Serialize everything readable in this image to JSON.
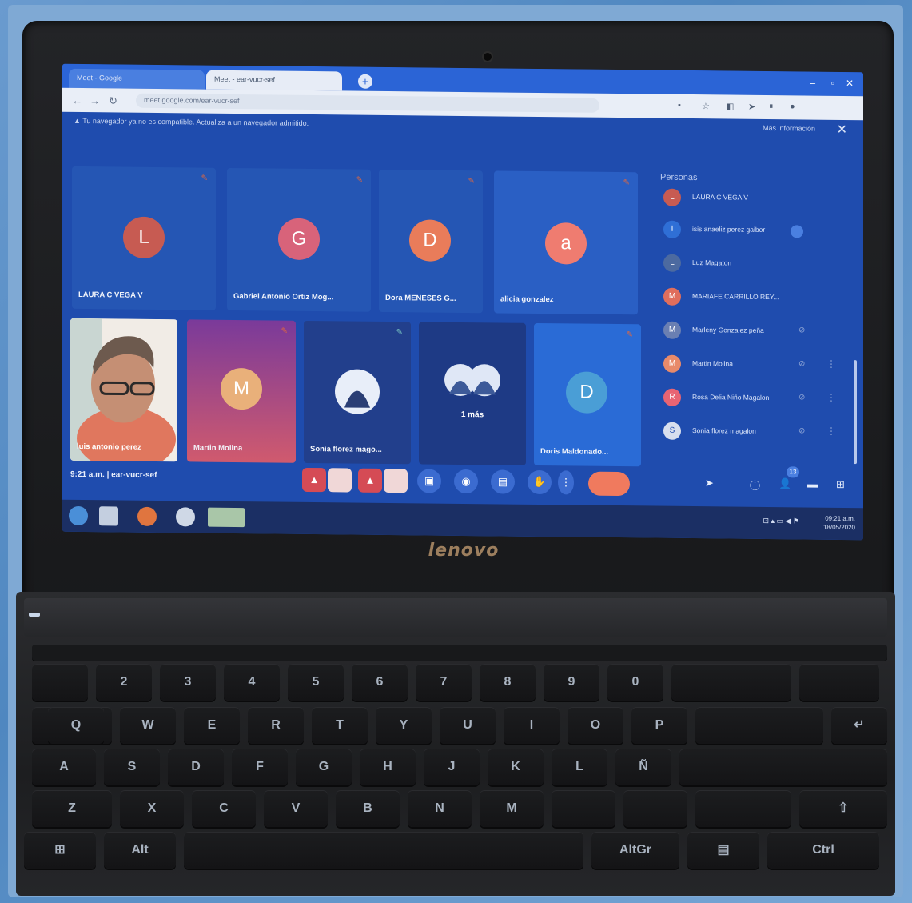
{
  "browser": {
    "tabs": [
      "Meet - Google",
      "Meet - ear-vucr-sef"
    ],
    "url": "meet.google.com/ear-vucr-sef",
    "warning": "Tu navegador ya no es compatible. Actualiza a un navegador admitido.",
    "more_info": "Más información"
  },
  "meet": {
    "tiles_top": [
      {
        "initial": "L",
        "name": "LAURA C VEGA V",
        "color": "#c75b52"
      },
      {
        "initial": "G",
        "name": "Gabriel Antonio Ortiz Mog...",
        "color": "#d8637a"
      },
      {
        "initial": "D",
        "name": "Dora MENESES G...",
        "color": "#e97c5a"
      },
      {
        "initial": "a",
        "name": "alicia gonzalez",
        "color": "#ef7c70"
      }
    ],
    "tiles_bottom": [
      {
        "name": "luis antonio perez"
      },
      {
        "initial": "M",
        "name": "Martin Molina"
      },
      {
        "name": "Sonia florez mago..."
      },
      {
        "name": "",
        "extra": "1 más"
      },
      {
        "initial": "D",
        "name": "Doris Maldonado..."
      }
    ],
    "time_code": "9:21 a.m.  |  ear-vucr-sef",
    "people_header": "Personas",
    "people": [
      {
        "initial": "L",
        "name": "LAURA C VEGA V",
        "color": "#c75b52"
      },
      {
        "initial": "I",
        "name": "isis anaeliz perez gaibor",
        "color": "#2f6fd6"
      },
      {
        "initial": "L",
        "name": "Luz Magaton",
        "color": "#4c6aa0"
      },
      {
        "initial": "M",
        "name": "MARIAFE CARRILLO REY...",
        "color": "#e06e5c"
      },
      {
        "initial": "M",
        "name": "Marleny Gonzalez peña",
        "color": "#6a7fb2"
      },
      {
        "initial": "M",
        "name": "Martin Molina",
        "color": "#e88a6a"
      },
      {
        "initial": "R",
        "name": "Rosa Delia Niño Magalon",
        "color": "#e86473"
      },
      {
        "initial": "S",
        "name": "Sonia florez magalon",
        "color": "#d8dfee"
      }
    ],
    "badge_count": "13"
  },
  "taskbar": {
    "time": "09:21 a.m.",
    "date": "18/05/2020"
  },
  "laptop": {
    "brand": "lenovo"
  },
  "keyboard": {
    "row_numbers": [
      "2",
      "3",
      "4",
      "5",
      "6",
      "7",
      "8",
      "9",
      "0"
    ],
    "row_q": [
      "Q",
      "W",
      "E",
      "R",
      "T",
      "Y",
      "U",
      "I",
      "O",
      "P"
    ],
    "row_a": [
      "A",
      "S",
      "D",
      "F",
      "G",
      "H",
      "J",
      "K",
      "L",
      "Ñ"
    ],
    "row_z": [
      "Z",
      "X",
      "C",
      "V",
      "B",
      "N",
      "M"
    ],
    "alt": "Alt",
    "altgr": "AltGr",
    "ctrl": "Ctrl"
  },
  "colors": {
    "screen_bg": "#1f4cae",
    "tile_bg": "#2556b4",
    "end_call": "#f07a5e"
  }
}
